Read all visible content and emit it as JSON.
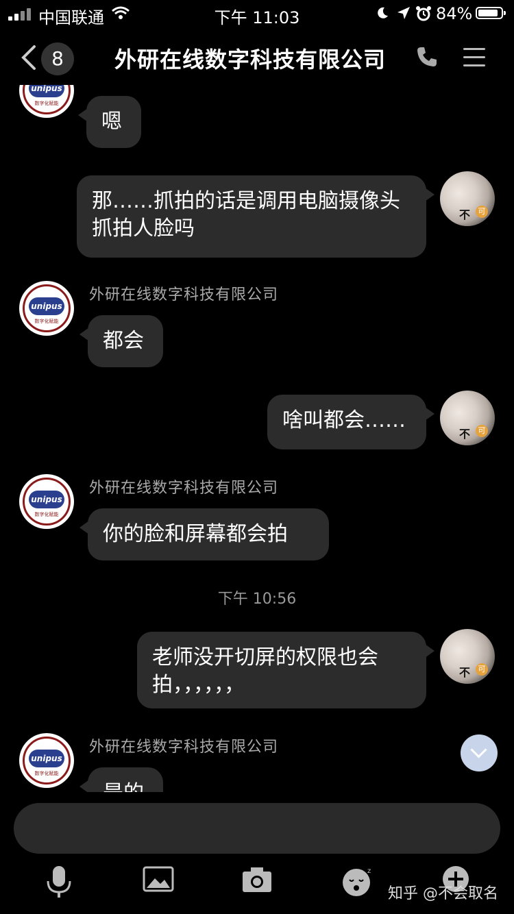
{
  "status_bar": {
    "carrier": "中国联通",
    "time": "下午 11:03",
    "battery": "84%"
  },
  "nav": {
    "back_count": "8",
    "title": "外研在线数字科技有限公司"
  },
  "avatar_text": {
    "company_logo": "unipus",
    "company_sub": "数字化赋能",
    "user_tag": "不",
    "user_coin": "可"
  },
  "messages": [
    {
      "side": "left",
      "text": "嗯"
    },
    {
      "side": "right",
      "text": "那……抓拍的话是调用电脑摄像头抓拍人脸吗"
    },
    {
      "side": "left",
      "sender": "外研在线数字科技有限公司",
      "text": "都会"
    },
    {
      "side": "right",
      "text": "啥叫都会……"
    },
    {
      "side": "left",
      "sender": "外研在线数字科技有限公司",
      "text": "你的脸和屏幕都会拍"
    },
    {
      "timestamp": "下午 10:56"
    },
    {
      "side": "right",
      "text": "老师没开切屏的权限也会拍，，，，，，"
    },
    {
      "side": "left",
      "sender": "外研在线数字科技有限公司",
      "text": "是的"
    }
  ],
  "toolbar": [
    "microphone-icon",
    "image-icon",
    "camera-icon",
    "emoji-icon",
    "plus-icon"
  ],
  "watermark": "知乎 @不会取名"
}
